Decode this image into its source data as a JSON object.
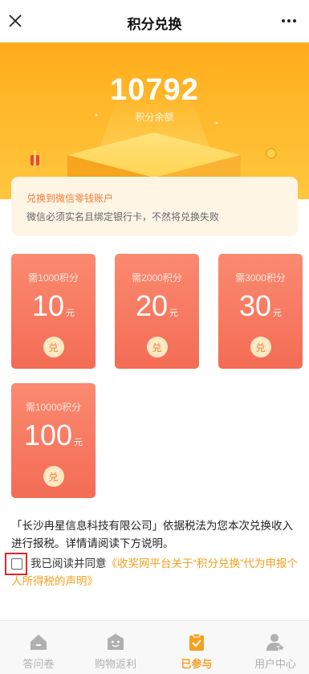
{
  "header": {
    "title": "积分兑换"
  },
  "balance": {
    "points": "10792",
    "label": "积分余额"
  },
  "notice": {
    "title": "兑换到微信零钱账户",
    "description": "微信必须实名且绑定银行卡，不然将兑换失败"
  },
  "rewards": [
    {
      "need": "需1000积分",
      "amount": "10",
      "unit": "元",
      "button": "兑"
    },
    {
      "need": "需2000积分",
      "amount": "20",
      "unit": "元",
      "button": "兑"
    },
    {
      "need": "需3000积分",
      "amount": "30",
      "unit": "元",
      "button": "兑"
    },
    {
      "need": "需10000积分",
      "amount": "100",
      "unit": "元",
      "button": "兑"
    }
  ],
  "legal": {
    "text": "「长沙冉星信息科技有限公司」依据税法为您本次兑换收入进行报税。详情请阅读下方说明。",
    "agree_prefix": "我已阅读并同意",
    "agree_link": "《收奖网平台关于“积分兑换”代为申报个人所得税的声明》"
  },
  "nav": {
    "items": [
      {
        "label": "答问卷",
        "icon": "home-icon"
      },
      {
        "label": "购物返利",
        "icon": "shop-icon"
      },
      {
        "label": "已参与",
        "icon": "clipboard-check-icon"
      },
      {
        "label": "用户中心",
        "icon": "user-star-icon"
      }
    ],
    "active_color": "#f5a020",
    "inactive_color": "#b0b0b0"
  },
  "colors": {
    "hero": "#ffb224",
    "card": "#f57a60",
    "accent": "#f5a020"
  }
}
